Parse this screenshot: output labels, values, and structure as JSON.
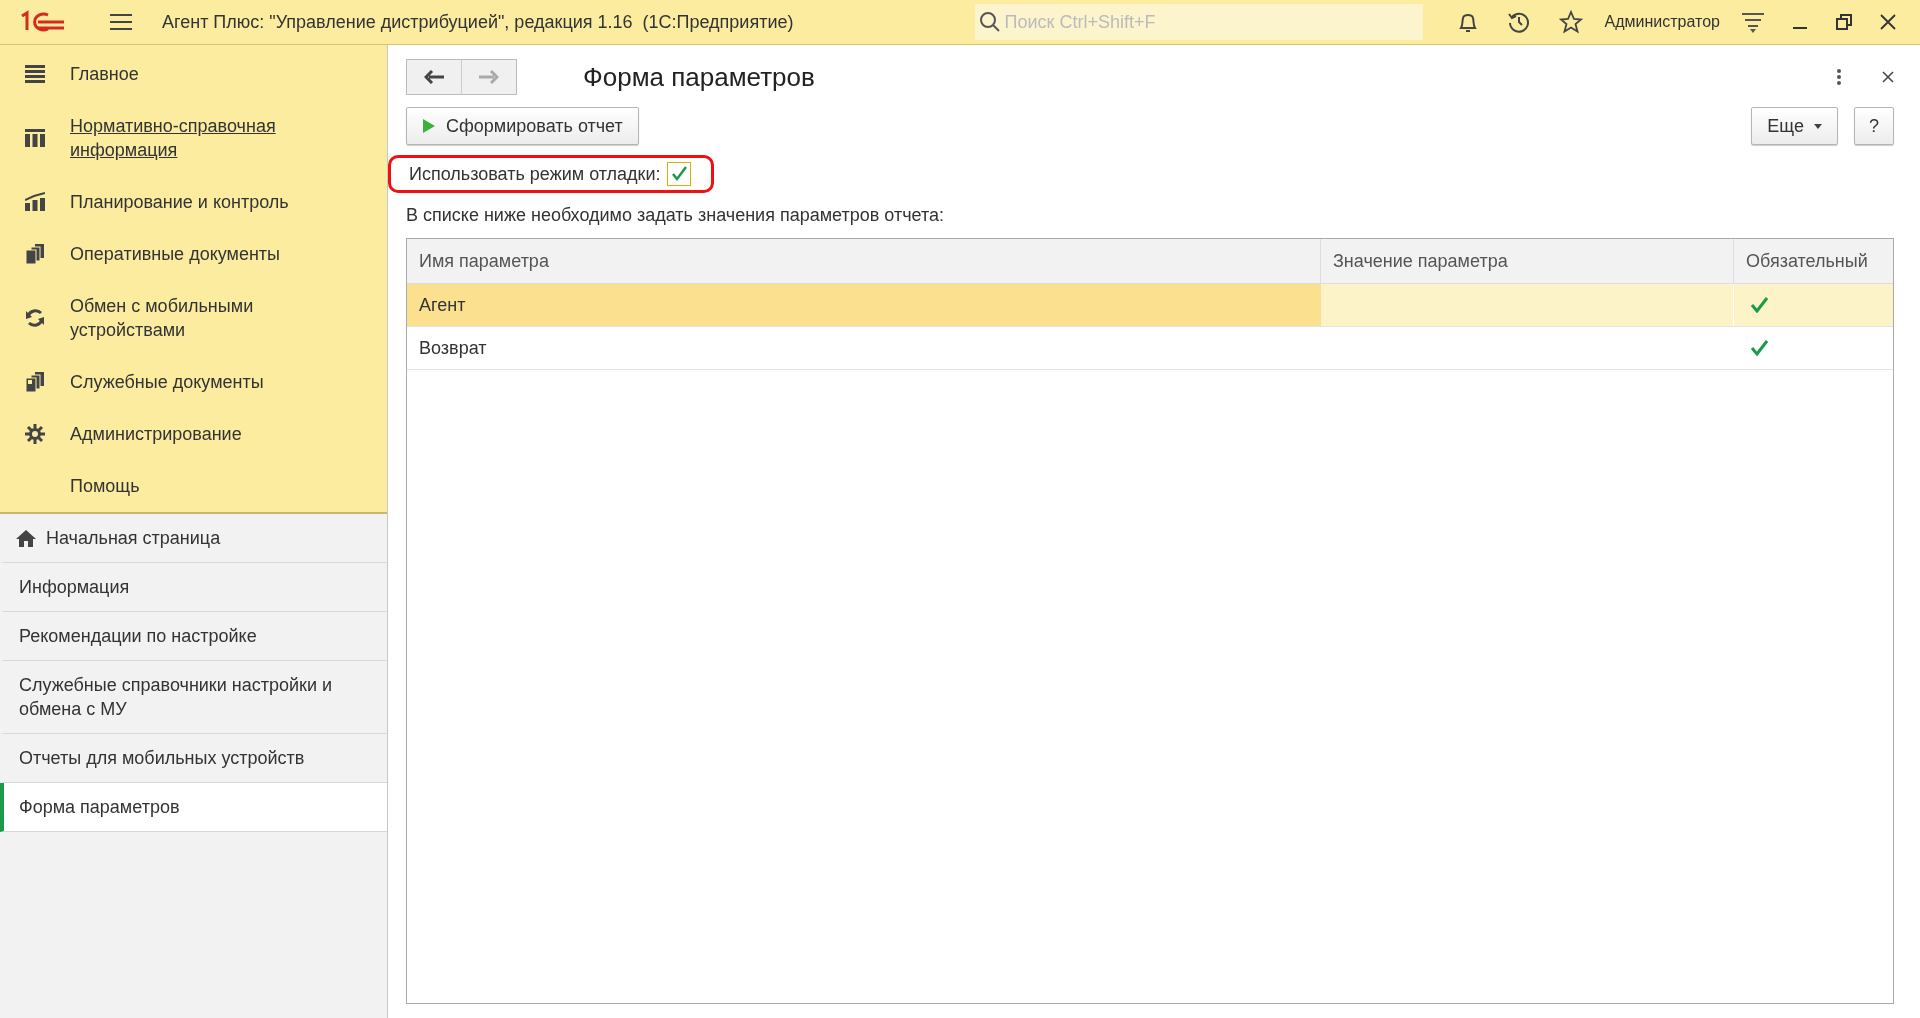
{
  "window": {
    "title": "Агент Плюс: \"Управление дистрибуцией\", редакция 1.16  (1С:Предприятие)",
    "search": {
      "placeholder": "Поиск Ctrl+Shift+F"
    },
    "user": "Администратор"
  },
  "sections": [
    {
      "label": "Главное",
      "hovered": false
    },
    {
      "label": "Нормативно-справочная информация",
      "hovered": true
    },
    {
      "label": "Планирование и контроль",
      "hovered": false
    },
    {
      "label": "Оперативные документы",
      "hovered": false
    },
    {
      "label": "Обмен с мобильными устройствами",
      "hovered": false
    },
    {
      "label": "Служебные документы",
      "hovered": false
    },
    {
      "label": "Администрирование",
      "hovered": false
    },
    {
      "label": "Помощь",
      "hovered": false
    }
  ],
  "open_pages": [
    {
      "label": "Начальная страница",
      "selected": false
    },
    {
      "label": "Информация",
      "selected": false
    },
    {
      "label": "Рекомендации по настройке",
      "selected": false
    },
    {
      "label": "Служебные справочники настройки и обмена с МУ",
      "selected": false
    },
    {
      "label": "Отчеты для мобильных устройств",
      "selected": false
    },
    {
      "label": "Форма параметров",
      "selected": true
    }
  ],
  "form": {
    "title": "Форма параметров",
    "back": {
      "disabled": false
    },
    "forward": {
      "disabled": true
    },
    "generate_button": "Сформировать отчет",
    "more_button": "Еще",
    "help_button": "?",
    "debug": {
      "label": "Использовать режим отладки:",
      "checked": true,
      "highlighted": true
    },
    "note": "В списке ниже необходимо задать значения параметров отчета:",
    "table": {
      "columns": [
        "Имя параметра",
        "Значение параметра",
        "Обязательный"
      ],
      "rows": [
        {
          "name": "Агент",
          "required": true,
          "selected": true
        },
        {
          "name": "Возврат",
          "required": true,
          "selected": false
        }
      ]
    }
  }
}
